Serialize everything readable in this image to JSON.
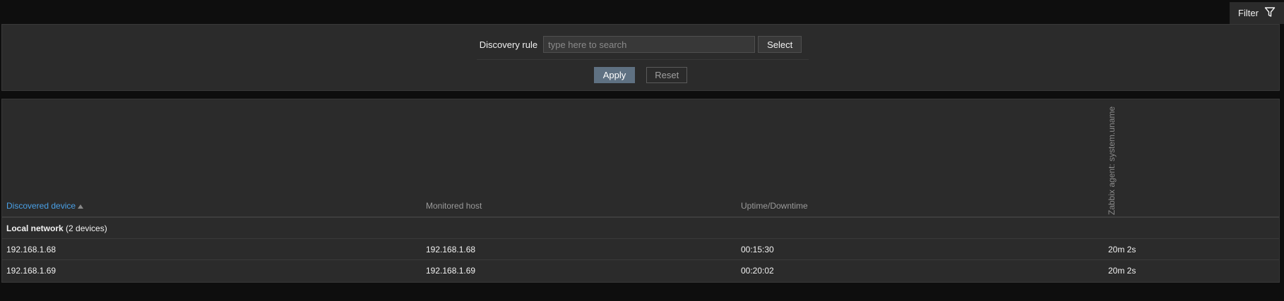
{
  "filter": {
    "tab_label": "Filter",
    "discovery_rule_label": "Discovery rule",
    "search_placeholder": "type here to search",
    "search_value": "",
    "select_label": "Select",
    "apply_label": "Apply",
    "reset_label": "Reset"
  },
  "table": {
    "columns": {
      "discovered_device": "Discovered device",
      "monitored_host": "Monitored host",
      "uptime_downtime": "Uptime/Downtime",
      "zabbix_agent": "Zabbix agent: system.uname"
    },
    "sorted_column": "discovered_device",
    "sort_direction": "ascending",
    "group": {
      "name": "Local network",
      "count_text": "(2 devices)"
    },
    "rows": [
      {
        "device": "192.168.1.68",
        "host": "192.168.1.68",
        "uptime": "00:15:30",
        "agent": "20m 2s"
      },
      {
        "device": "192.168.1.69",
        "host": "192.168.1.69",
        "uptime": "00:20:02",
        "agent": "20m 2s"
      }
    ]
  },
  "colors": {
    "background": "#0e0e0e",
    "panel": "#2b2b2b",
    "link_blue": "#4aa0e6",
    "apply_button": "#5f7182"
  },
  "icons": {
    "filter": "filter-funnel-icon",
    "sort": "sort-ascending-icon"
  }
}
